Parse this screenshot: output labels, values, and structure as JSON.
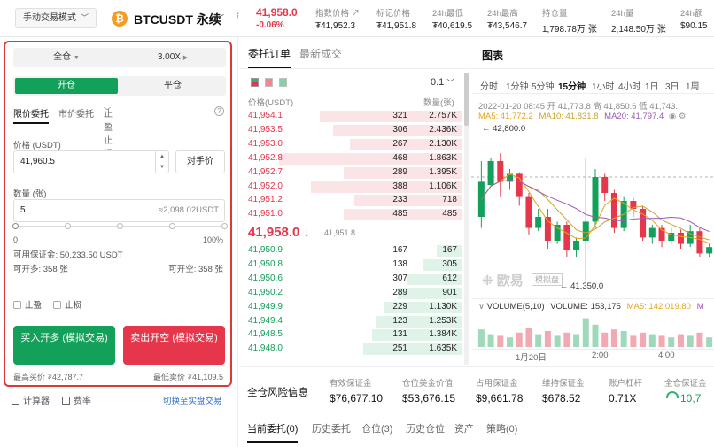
{
  "header": {
    "mode_label": "手动交易模式",
    "coin_symbol": "₿",
    "pair": "BTCUSDT 永续",
    "last_price": "41,958.0",
    "change_pct": "-0.06%",
    "stats": [
      {
        "label": "指数价格",
        "value": "₮41,952.3"
      },
      {
        "label": "标记价格",
        "value": "₮41,951.8"
      },
      {
        "label": "24h最低",
        "value": "₮40,619.5"
      },
      {
        "label": "24h最高",
        "value": "₮43,546.7"
      },
      {
        "label": "持仓量",
        "value": "1,798.78万 张"
      },
      {
        "label": "24h量",
        "value": "2,148.50万 张"
      },
      {
        "label": "24h额",
        "value": "$90.15"
      }
    ]
  },
  "order_panel": {
    "margin_mode": "全仓",
    "leverage": "3.00X",
    "open_tab": "开仓",
    "close_tab": "平仓",
    "order_types": [
      "限价委托",
      "市价委托",
      "止盈止损"
    ],
    "price_label": "价格 (USDT)",
    "price_value": "41,960.5",
    "opponent_price_btn": "对手价",
    "qty_label": "数量 (张)",
    "qty_value": "5",
    "qty_equiv": "≈2,098.02USDT",
    "slider_min": "0",
    "slider_max": "100%",
    "slider_value_pct": 0,
    "available_margin": "可用保证金: 50,233.50 USDT",
    "can_long": "可开多: 358 张",
    "can_short": "可开空: 358 张",
    "take_profit": "止盈",
    "stop_loss": "止损",
    "buy_btn": "买入开多 (模拟交易)",
    "sell_btn": "卖出开空 (模拟交易)",
    "max_buy": "最高买价 ₮42,787.7",
    "min_sell": "最低卖价 ₮41,109.5",
    "calculator": "计算器",
    "fees": "费率",
    "switch_real": "切换至实盘交易"
  },
  "orderbook": {
    "tab_active": "委托订单",
    "tab_inactive": "最新成交",
    "precision": "0.1",
    "col_price": "价格(USDT)",
    "col_qty": "数量(张)",
    "asks": [
      {
        "price": "41,954.1",
        "qty": "321",
        "total": "2.757K",
        "depth": 0.66
      },
      {
        "price": "41,953.5",
        "qty": "306",
        "total": "2.436K",
        "depth": 0.6
      },
      {
        "price": "41,953.0",
        "qty": "267",
        "total": "2.130K",
        "depth": 0.52
      },
      {
        "price": "41,952.8",
        "qty": "468",
        "total": "1.863K",
        "depth": 0.85
      },
      {
        "price": "41,952.7",
        "qty": "289",
        "total": "1.395K",
        "depth": 0.55
      },
      {
        "price": "41,952.0",
        "qty": "388",
        "total": "1.106K",
        "depth": 0.7
      },
      {
        "price": "41,951.2",
        "qty": "233",
        "total": "718",
        "depth": 0.5
      },
      {
        "price": "41,951.0",
        "qty": "485",
        "total": "485",
        "depth": 0.55
      }
    ],
    "mid_price": "41,958.0 ↓",
    "mid_ref": "41,951.8",
    "bids": [
      {
        "price": "41,950.9",
        "qty": "167",
        "total": "167",
        "depth": 0.12
      },
      {
        "price": "41,950.8",
        "qty": "138",
        "total": "305",
        "depth": 0.18
      },
      {
        "price": "41,950.6",
        "qty": "307",
        "total": "612",
        "depth": 0.26
      },
      {
        "price": "41,950.2",
        "qty": "289",
        "total": "901",
        "depth": 0.3
      },
      {
        "price": "41,949.9",
        "qty": "229",
        "total": "1.130K",
        "depth": 0.36
      },
      {
        "price": "41,949.4",
        "qty": "123",
        "total": "1.253K",
        "depth": 0.4
      },
      {
        "price": "41,948.5",
        "qty": "131",
        "total": "1.384K",
        "depth": 0.42
      },
      {
        "price": "41,948.0",
        "qty": "251",
        "total": "1.635K",
        "depth": 0.46
      }
    ]
  },
  "chart": {
    "title": "图表",
    "timeframes": [
      "分时",
      "1分钟",
      "5分钟",
      "15分钟",
      "1小时",
      "4小时",
      "1日",
      "3日",
      "1周"
    ],
    "active_timeframe": "15分钟",
    "ohlc_line": "2022-01-20 08:45  开 41,773.8  高 41,850.6  低 41,743.",
    "ma_line": {
      "ma5": "MA5: 41,772.2",
      "ma10": "MA10: 41,831.8",
      "ma20": "MA20: 41,797.4"
    },
    "high_marker": "42,800.0",
    "low_marker": "41,350.0",
    "watermark": "欧易",
    "watermark_sub": "模拟盘",
    "volume_line": {
      "label": "VOLUME(5,10)",
      "vol": "VOLUME: 153,175",
      "ma5": "MA5: 142,019.80",
      "ma10": "M"
    },
    "x_labels": [
      "1月20日",
      "2:00",
      "4:00"
    ],
    "colors": {
      "up": "#13a05a",
      "down": "#e6364b",
      "ma5": "#e8a317",
      "ma10": "#c9a227",
      "ma20": "#9b59b6"
    },
    "candles": [
      {
        "o": 0.55,
        "c": 0.33,
        "h": 0.2,
        "l": 0.62
      },
      {
        "o": 0.35,
        "c": 0.2,
        "h": 0.18,
        "l": 0.36
      },
      {
        "o": 0.2,
        "c": 0.33,
        "h": 0.15,
        "l": 0.42
      },
      {
        "o": 0.33,
        "c": 0.28,
        "h": 0.25,
        "l": 0.38
      },
      {
        "o": 0.28,
        "c": 0.42,
        "h": 0.27,
        "l": 0.48
      },
      {
        "o": 0.42,
        "c": 0.62,
        "h": 0.4,
        "l": 0.66
      },
      {
        "o": 0.62,
        "c": 0.55,
        "h": 0.5,
        "l": 0.64
      },
      {
        "o": 0.55,
        "c": 0.7,
        "h": 0.5,
        "l": 0.75
      },
      {
        "o": 0.7,
        "c": 0.6,
        "h": 0.58,
        "l": 0.72
      },
      {
        "o": 0.6,
        "c": 0.76,
        "h": 0.58,
        "l": 0.8
      },
      {
        "o": 0.76,
        "c": 0.7,
        "h": 0.68,
        "l": 0.8
      },
      {
        "o": 0.7,
        "c": 0.58,
        "h": 0.18,
        "l": 0.96
      },
      {
        "o": 0.58,
        "c": 0.3,
        "h": 0.25,
        "l": 0.62
      },
      {
        "o": 0.3,
        "c": 0.4,
        "h": 0.28,
        "l": 0.45
      },
      {
        "o": 0.4,
        "c": 0.62,
        "h": 0.38,
        "l": 0.65
      },
      {
        "o": 0.62,
        "c": 0.45,
        "h": 0.42,
        "l": 0.64
      },
      {
        "o": 0.45,
        "c": 0.5,
        "h": 0.43,
        "l": 0.55
      },
      {
        "o": 0.5,
        "c": 0.68,
        "h": 0.48,
        "l": 0.7
      },
      {
        "o": 0.68,
        "c": 0.62,
        "h": 0.6,
        "l": 0.72
      },
      {
        "o": 0.62,
        "c": 0.7,
        "h": 0.6,
        "l": 0.74
      },
      {
        "o": 0.7,
        "c": 0.65,
        "h": 0.62,
        "l": 0.72
      },
      {
        "o": 0.65,
        "c": 0.72,
        "h": 0.63,
        "l": 0.75
      },
      {
        "o": 0.72,
        "c": 0.64,
        "h": 0.6,
        "l": 0.74
      },
      {
        "o": 0.64,
        "c": 0.78,
        "h": 0.62,
        "l": 0.8
      },
      {
        "o": 0.78,
        "c": 0.74,
        "h": 0.72,
        "l": 0.8
      }
    ],
    "volumes": [
      0.55,
      0.4,
      0.35,
      0.3,
      0.45,
      0.6,
      0.4,
      0.5,
      0.35,
      0.45,
      0.4,
      0.9,
      0.7,
      0.45,
      0.55,
      0.5,
      0.35,
      0.45,
      0.4,
      0.35,
      0.3,
      0.4,
      0.35,
      0.45,
      0.3
    ]
  },
  "risk": {
    "label": "全仓风险信息",
    "items": [
      {
        "label": "有效保证金",
        "value": "$76,677.10"
      },
      {
        "label": "仓位美金价值",
        "value": "$53,676.15"
      },
      {
        "label": "占用保证金",
        "value": "$9,661.78"
      },
      {
        "label": "维持保证金",
        "value": "$678.52"
      },
      {
        "label": "账户杠杆",
        "value": "0.71X"
      },
      {
        "label": "全仓保证金",
        "value": "10,7"
      }
    ]
  },
  "bottom_tabs": [
    "当前委托(0)",
    "历史委托",
    "仓位(3)",
    "历史仓位",
    "资产",
    "策略(0)"
  ]
}
